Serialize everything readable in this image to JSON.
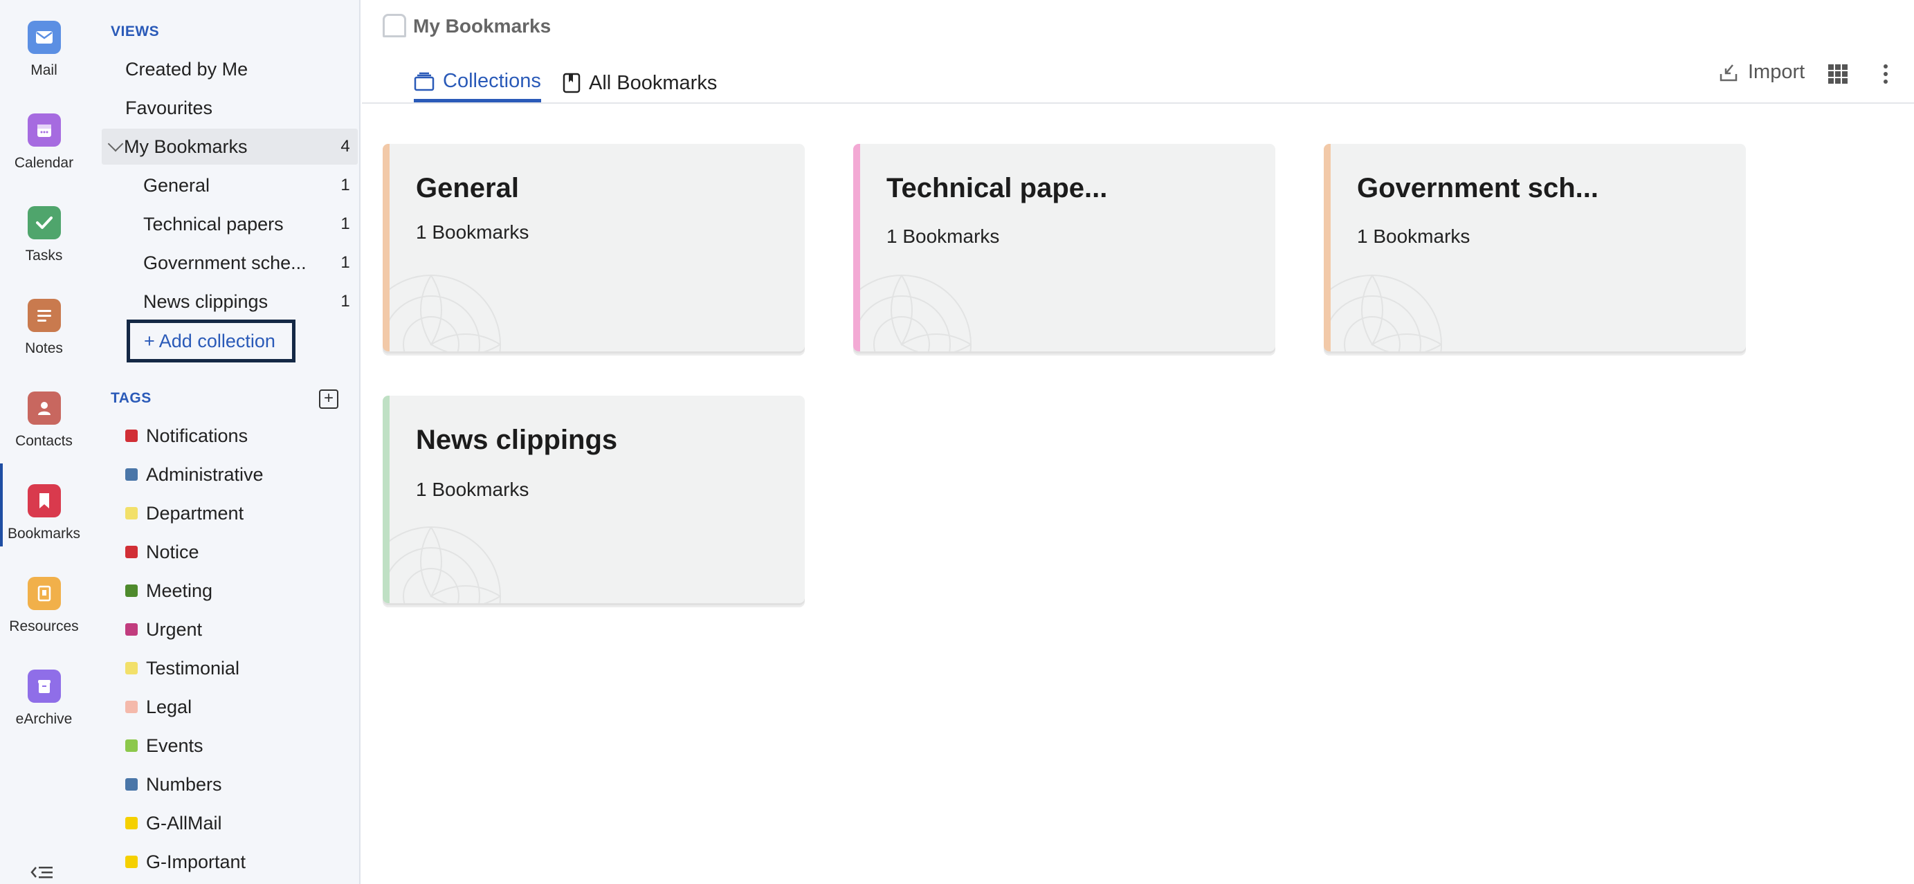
{
  "rail": [
    {
      "label": "Mail",
      "icon": "mail-icon",
      "color": "#5b8fe3"
    },
    {
      "label": "Calendar",
      "icon": "calendar-icon",
      "color": "#a66be0"
    },
    {
      "label": "Tasks",
      "icon": "tasks-icon",
      "color": "#4fa56c"
    },
    {
      "label": "Notes",
      "icon": "notes-icon",
      "color": "#c97a4e"
    },
    {
      "label": "Contacts",
      "icon": "contacts-icon",
      "color": "#c8675f"
    },
    {
      "label": "Bookmarks",
      "icon": "bookmarks-icon",
      "color": "#d93a4d",
      "active": true
    },
    {
      "label": "Resources",
      "icon": "resources-icon",
      "color": "#f1b04a"
    },
    {
      "label": "eArchive",
      "icon": "earchive-icon",
      "color": "#8f6ee8"
    }
  ],
  "nav": {
    "views_heading": "VIEWS",
    "views": [
      {
        "label": "Created by Me"
      },
      {
        "label": "Favourites"
      },
      {
        "label": "My Bookmarks",
        "count": "4",
        "selected": true
      }
    ],
    "collections": [
      {
        "label": "General",
        "count": "1"
      },
      {
        "label": "Technical papers",
        "count": "1"
      },
      {
        "label": "Government sche...",
        "count": "1"
      },
      {
        "label": "News clippings",
        "count": "1"
      }
    ],
    "add_collection": "+ Add collection",
    "tags_heading": "TAGS",
    "tags": [
      {
        "label": "Notifications",
        "color": "#d12f36"
      },
      {
        "label": "Administrative",
        "color": "#4a76a8"
      },
      {
        "label": "Department",
        "color": "#f2e06a"
      },
      {
        "label": "Notice",
        "color": "#d12f36"
      },
      {
        "label": "Meeting",
        "color": "#4e8a2c"
      },
      {
        "label": "Urgent",
        "color": "#c13c7e"
      },
      {
        "label": "Testimonial",
        "color": "#f2e06a"
      },
      {
        "label": "Legal",
        "color": "#f4b9ab"
      },
      {
        "label": "Events",
        "color": "#8cc84b"
      },
      {
        "label": "Numbers",
        "color": "#4a76a8"
      },
      {
        "label": "G-AllMail",
        "color": "#f5d000"
      },
      {
        "label": "G-Important",
        "color": "#f5d000"
      }
    ]
  },
  "header": {
    "title": "My Bookmarks",
    "tabs": [
      {
        "label": "Collections",
        "active": true
      },
      {
        "label": "All Bookmarks"
      }
    ],
    "import_label": "Import"
  },
  "cards": [
    {
      "title": "General",
      "subtitle": "1 Bookmarks",
      "color": "#f2c9a8"
    },
    {
      "title": "Technical pape...",
      "subtitle": "1 Bookmarks",
      "color": "#f3a9d4"
    },
    {
      "title": "Government sch...",
      "subtitle": "1 Bookmarks",
      "color": "#f2c9a8"
    },
    {
      "title": "News clippings",
      "subtitle": "1 Bookmarks",
      "color": "#bfe0c4"
    }
  ]
}
